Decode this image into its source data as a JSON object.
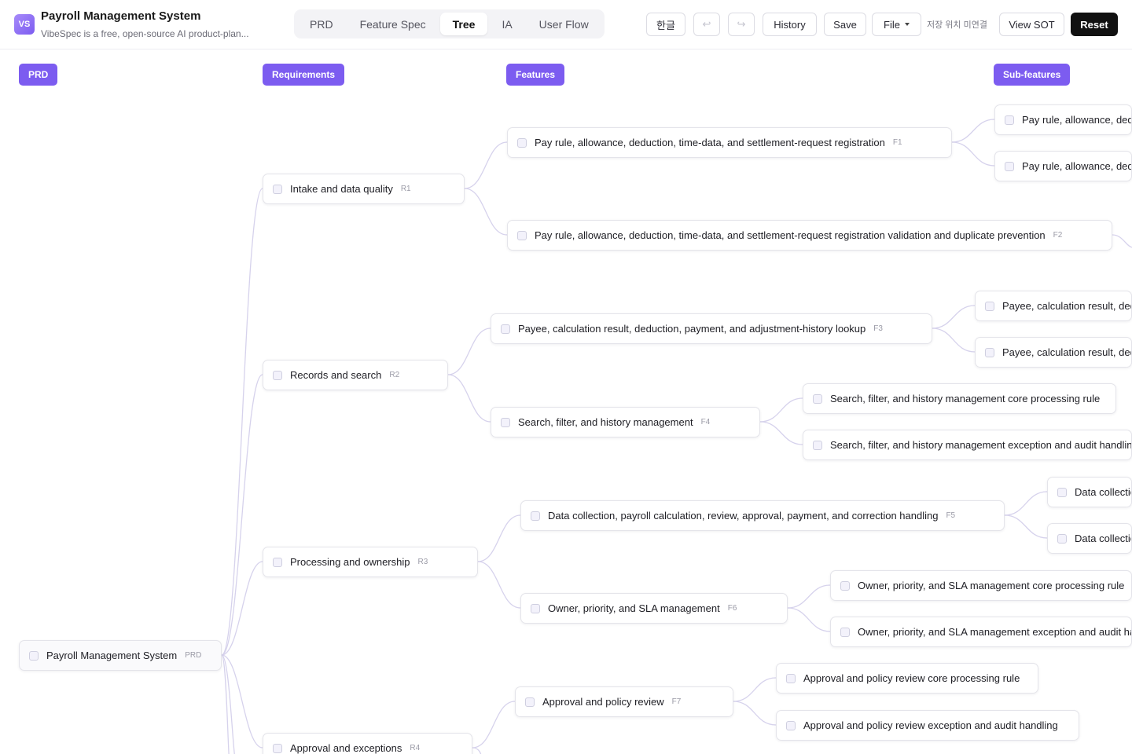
{
  "app": {
    "logo": "VS",
    "title": "Payroll Management System",
    "subtitle": "VibeSpec is a free, open-source AI product-plan..."
  },
  "tabs": [
    {
      "label": "PRD",
      "active": false
    },
    {
      "label": "Feature Spec",
      "active": false
    },
    {
      "label": "Tree",
      "active": true
    },
    {
      "label": "IA",
      "active": false
    },
    {
      "label": "User Flow",
      "active": false
    }
  ],
  "toolbar": {
    "language": "한글",
    "undo_icon": "undo-icon",
    "redo_icon": "redo-icon",
    "history": "History",
    "save": "Save",
    "file": "File",
    "save_status": "저장 위치 미연결",
    "view_sot": "View SOT",
    "reset": "Reset"
  },
  "columns": {
    "prd": "PRD",
    "requirements": "Requirements",
    "features": "Features",
    "subfeatures": "Sub-features"
  },
  "tree": {
    "root": {
      "label": "Payroll Management System",
      "tag": "PRD"
    },
    "requirements": [
      {
        "label": "Intake and data quality",
        "tag": "R1"
      },
      {
        "label": "Records and search",
        "tag": "R2"
      },
      {
        "label": "Processing and ownership",
        "tag": "R3"
      },
      {
        "label": "Approval and exceptions",
        "tag": "R4"
      }
    ],
    "features": [
      {
        "label": "Pay rule, allowance, deduction, time-data, and settlement-request registration",
        "tag": "F1"
      },
      {
        "label": "Pay rule, allowance, deduction, time-data, and settlement-request registration validation and duplicate prevention",
        "tag": "F2"
      },
      {
        "label": "Payee, calculation result, deduction, payment, and adjustment-history lookup",
        "tag": "F3"
      },
      {
        "label": "Search, filter, and history management",
        "tag": "F4"
      },
      {
        "label": "Data collection, payroll calculation, review, approval, payment, and correction handling",
        "tag": "F5"
      },
      {
        "label": "Owner, priority, and SLA management",
        "tag": "F6"
      },
      {
        "label": "Approval and policy review",
        "tag": "F7"
      }
    ],
    "subfeatures": [
      {
        "label": "Pay rule, allowance, dedu"
      },
      {
        "label": "Pay rule, allowance, dedu"
      },
      {
        "label": "Payee, calculation result, dedu"
      },
      {
        "label": "Payee, calculation result, dedu"
      },
      {
        "label": "Search, filter, and history management core processing rule"
      },
      {
        "label": "Search, filter, and history management exception and audit handling"
      },
      {
        "label": "Data collectio"
      },
      {
        "label": "Data collectio"
      },
      {
        "label": "Owner, priority, and SLA management core processing rule"
      },
      {
        "label": "Owner, priority, and SLA management exception and audit han"
      },
      {
        "label": "Approval and policy review core processing rule"
      },
      {
        "label": "Approval and policy review exception and audit handling"
      }
    ]
  }
}
